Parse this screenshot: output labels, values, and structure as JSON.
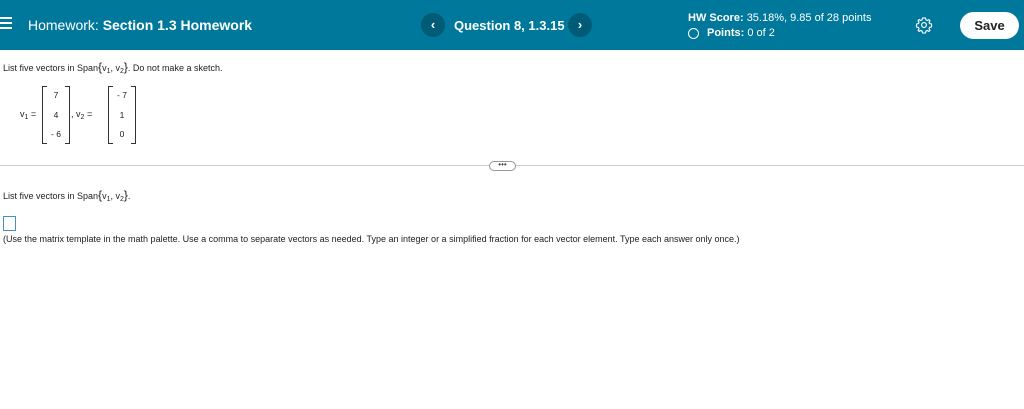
{
  "header": {
    "title_prefix": "Homework:",
    "title_name": "Section 1.3 Homework",
    "prev_label": "‹",
    "next_label": "›",
    "question_label": "Question 8, 1.3.15",
    "score_label": "HW Score:",
    "score_value": "35.18%, 9.85 of 28 points",
    "points_label": "Points:",
    "points_value": "0 of 2",
    "save_label": "Save",
    "icons": [
      "menu-icon",
      "chevron-left-icon",
      "chevron-right-icon",
      "circle-icon",
      "gear-icon"
    ],
    "color": "#00789c"
  },
  "problem": {
    "prompt_prefix": "List five vectors in Span",
    "open_brace": "{",
    "v1": "v",
    "v1_sub": "1",
    "comma": ",",
    "v2": "v",
    "v2_sub": "2",
    "close_brace": "}",
    "prompt_suffix": ". Do not make a sketch.",
    "v1_label": "v",
    "v1_label_sub": "1",
    "equals": "=",
    "v2_label": "v",
    "v2_label_sub": "2",
    "v1_entries": [
      "7",
      "4",
      "- 6"
    ],
    "v2_entries": [
      "- 7",
      "1",
      "0"
    ]
  },
  "answer": {
    "expand_label": "•••",
    "prompt_prefix": "List five vectors in Span",
    "prompt_suffix": ".",
    "instructions": "(Use the matrix template in the math palette. Use a comma to separate vectors as needed. Type an integer or a simplified fraction for each vector element. Type each answer only once.)"
  }
}
